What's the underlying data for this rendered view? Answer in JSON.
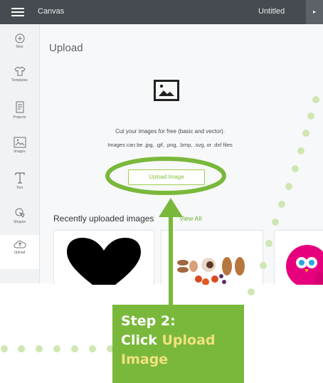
{
  "topbar": {
    "app_title": "Canvas",
    "doc_title": "Untitled"
  },
  "sidebar": {
    "items": [
      {
        "label": "New",
        "icon": "plus-circle-icon"
      },
      {
        "label": "Templates",
        "icon": "shirt-icon"
      },
      {
        "label": "Projects",
        "icon": "projects-icon"
      },
      {
        "label": "Images",
        "icon": "image-icon"
      },
      {
        "label": "Text",
        "icon": "text-icon"
      },
      {
        "label": "Shapes",
        "icon": "shapes-icon"
      },
      {
        "label": "Upload",
        "icon": "upload-cloud-icon"
      }
    ]
  },
  "main": {
    "heading": "Upload",
    "cut_text": "Cut your images for free (basic and vector).",
    "formats_text": "Images can be .jpg, .gif, .png, .bmp, .svg, or .dxf files",
    "upload_button": "Upload Image",
    "recent_heading": "Recently uploaded images",
    "view_all": "View All"
  },
  "callout": {
    "step": "Step 2:",
    "click": "Click",
    "highlight_line1": "Upload",
    "highlight_line2": "Image"
  },
  "colors": {
    "accent_green": "#7ab83b",
    "callout_text_highlight": "#f1e27e",
    "topbar": "#454b50"
  }
}
